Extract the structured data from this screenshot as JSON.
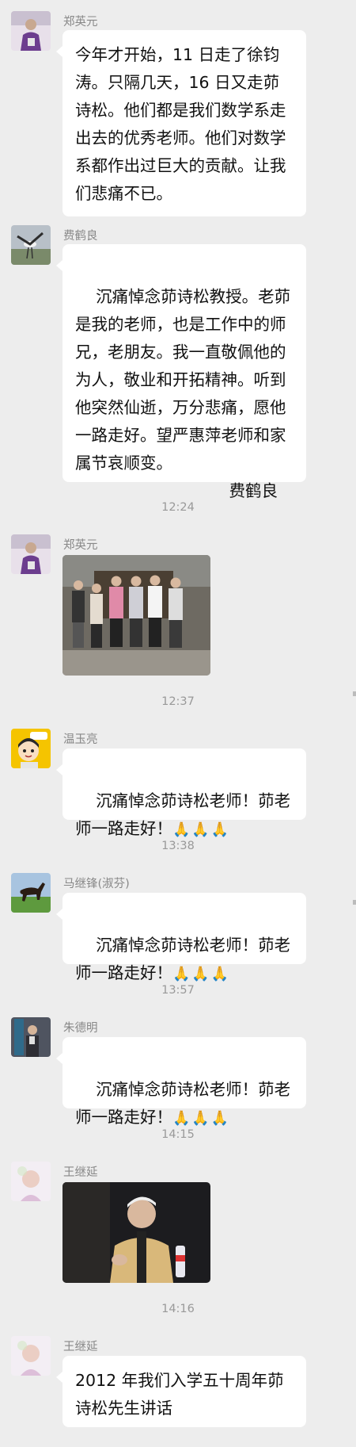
{
  "messages": [
    {
      "sender": "郑英元",
      "avatar_icon": "elderly-man-avatar",
      "text": "今年才开始，11 日走了徐钧涛。只隔几天，16 日又走茆诗松。他们都是我们数学系走出去的优秀老师。他们对数学系都作出过巨大的贡献。让我们悲痛不已。"
    },
    {
      "sender": "费鹤良",
      "avatar_icon": "crane-bird-avatar",
      "text": "沉痛悼念茆诗松教授。老茆是我的老师，也是工作中的师兄，老朋友。我一直敬佩他的为人，敬业和开拓精神。听到他突然仙逝，万分悲痛，愿他一路走好。望严惠萍老师和家属节哀顺变。",
      "signature": "费鹤良"
    }
  ],
  "times": [
    "12:24",
    "12:37",
    "13:38",
    "13:57",
    "14:15",
    "14:16"
  ],
  "photo_msgs": [
    {
      "sender": "郑英元",
      "photo_icon": "group-photo-image"
    },
    {
      "sender": "王继延",
      "photo_icon": "speaker-portrait-image"
    }
  ],
  "condolences": [
    {
      "sender": "温玉亮",
      "text": "沉痛悼念茆诗松老师！茆老师一路走好！",
      "emoji": "🙏🙏🙏"
    },
    {
      "sender": "马继锋(淑芬)",
      "text": "沉痛悼念茆诗松老师！茆老师一路走好！",
      "emoji": "🙏🙏🙏"
    },
    {
      "sender": "朱德明",
      "text": "沉痛悼念茆诗松老师！茆老师一路走好！",
      "emoji": "🙏🙏🙏"
    }
  ],
  "last_msg": {
    "sender": "王继延",
    "text": "2012 年我们入学五十周年茆诗松先生讲话"
  },
  "colors": {
    "background": "#ededed",
    "bubble": "#ffffff",
    "meta_text": "#999999"
  }
}
